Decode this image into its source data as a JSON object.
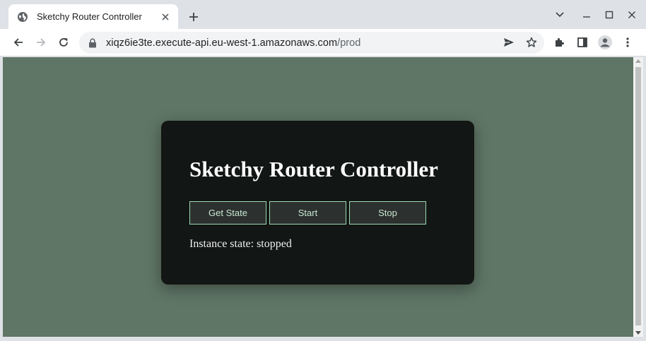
{
  "tab": {
    "title": "Sketchy Router Controller",
    "favicon": "globe-icon"
  },
  "toolbar": {
    "url_host": "xiqz6ie3te.execute-api.eu-west-1.amazonaws.com",
    "url_path": "/prod"
  },
  "page": {
    "heading": "Sketchy Router Controller",
    "buttons": {
      "get_state": "Get State",
      "start": "Start",
      "stop": "Stop"
    },
    "status_text": "Instance state: stopped"
  },
  "colors": {
    "page_background": "#5f7565",
    "card_background": "#121614",
    "button_border": "#9cd9b2",
    "button_text": "#c9e7d3"
  }
}
